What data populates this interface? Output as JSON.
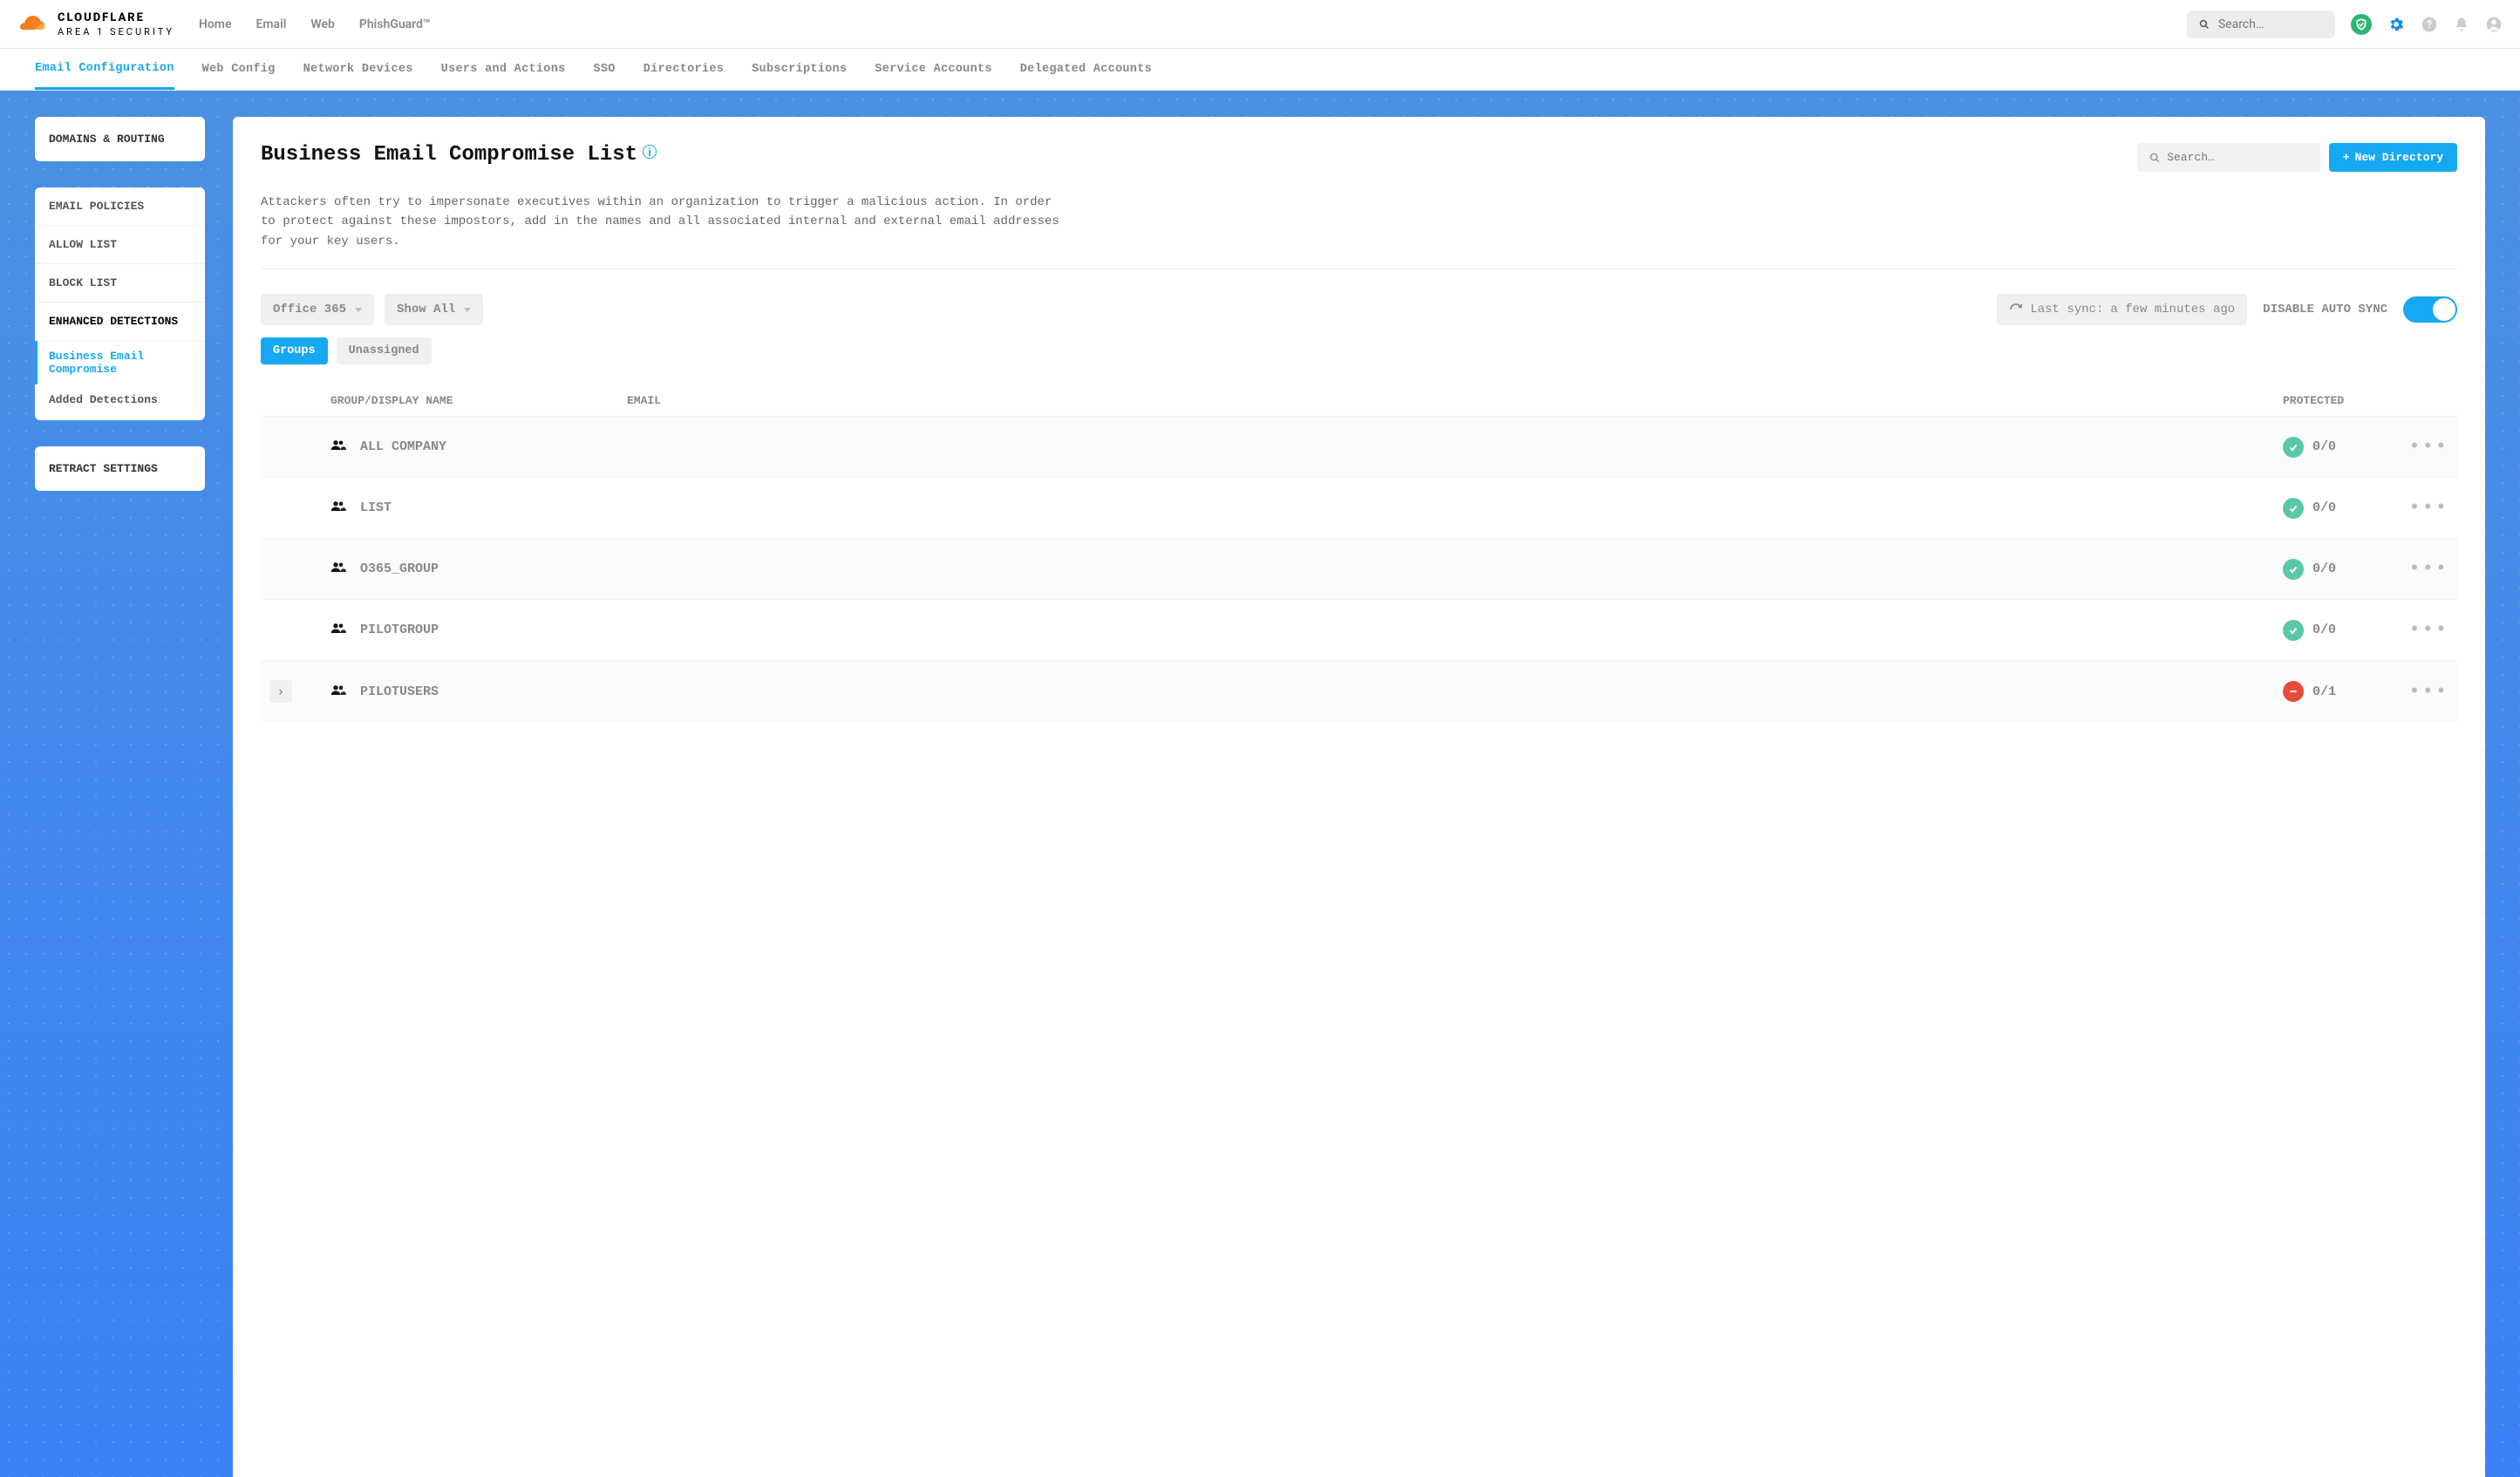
{
  "brand": {
    "main": "CLOUDFLARE",
    "sub": "AREA 1 SECURITY"
  },
  "topNav": {
    "home": "Home",
    "email": "Email",
    "web": "Web",
    "phishguard": "PhishGuard™"
  },
  "topSearchPlaceholder": "Search…",
  "subNav": {
    "emailConfig": "Email Configuration",
    "webConfig": "Web Config",
    "networkDevices": "Network Devices",
    "usersActions": "Users and Actions",
    "sso": "SSO",
    "directories": "Directories",
    "subscriptions": "Subscriptions",
    "serviceAccounts": "Service Accounts",
    "delegatedAccounts": "Delegated Accounts"
  },
  "sidebar": {
    "domainsRouting": "DOMAINS & ROUTING",
    "emailPolicies": "EMAIL POLICIES",
    "allowList": "ALLOW LIST",
    "blockList": "BLOCK LIST",
    "enhancedDetections": "ENHANCED DETECTIONS",
    "bec": "Business Email Compromise",
    "addedDetections": "Added Detections",
    "retractSettings": "RETRACT SETTINGS"
  },
  "page": {
    "title": "Business Email Compromise List",
    "infoSymbol": "i",
    "searchPlaceholder": "Search…",
    "newDirectoryLabel": "New Directory",
    "description": "Attackers often try to impersonate executives within an organization to trigger a malicious action. In order to protect against these impostors, add in the names and all associated internal and external email addresses for your key users."
  },
  "controls": {
    "directorySelect": "Office 365",
    "showSelect": "Show All",
    "lastSyncPrefix": "Last sync: ",
    "lastSyncValue": "a few minutes ago",
    "autoSyncLabel": "DISABLE AUTO SYNC",
    "pillGroups": "Groups",
    "pillUnassigned": "Unassigned"
  },
  "table": {
    "colName": "GROUP/DISPLAY NAME",
    "colEmail": "EMAIL",
    "colProtected": "PROTECTED",
    "rows": [
      {
        "name": "ALL COMPANY",
        "email": "",
        "protected": "0/0",
        "status": "ok",
        "expandable": false
      },
      {
        "name": "LIST",
        "email": "",
        "protected": "0/0",
        "status": "ok",
        "expandable": false
      },
      {
        "name": "O365_GROUP",
        "email": "",
        "protected": "0/0",
        "status": "ok",
        "expandable": false
      },
      {
        "name": "PILOTGROUP",
        "email": "",
        "protected": "0/0",
        "status": "ok",
        "expandable": false
      },
      {
        "name": "PILOTUSERS",
        "email": "",
        "protected": "0/1",
        "status": "bad",
        "expandable": true
      }
    ]
  }
}
